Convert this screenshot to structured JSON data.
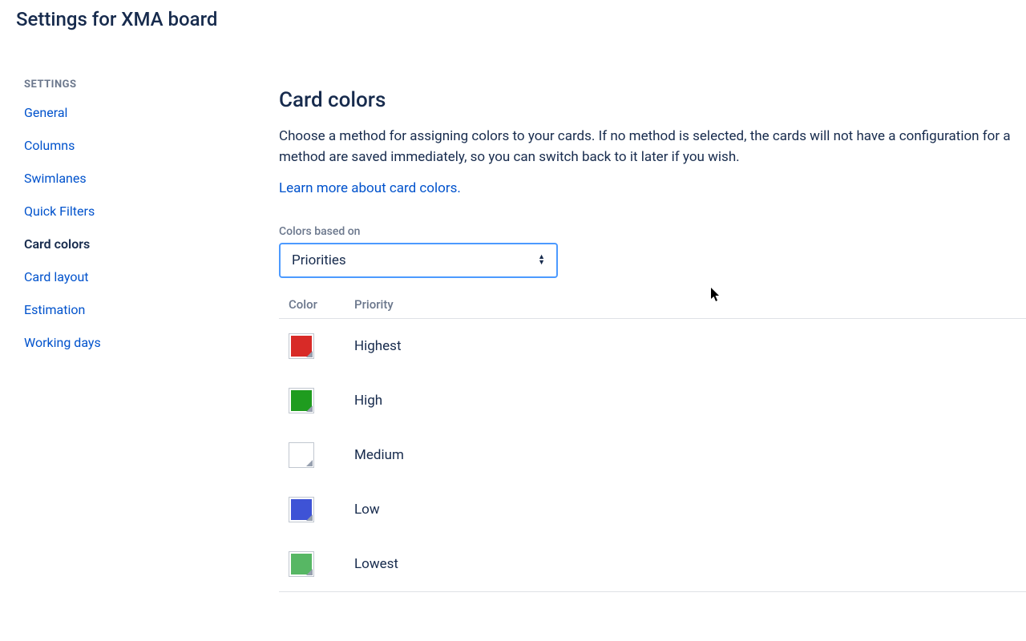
{
  "page": {
    "title": "Settings for XMA board"
  },
  "sidebar": {
    "header": "SETTINGS",
    "items": [
      {
        "label": "General",
        "active": false
      },
      {
        "label": "Columns",
        "active": false
      },
      {
        "label": "Swimlanes",
        "active": false
      },
      {
        "label": "Quick Filters",
        "active": false
      },
      {
        "label": "Card colors",
        "active": true
      },
      {
        "label": "Card layout",
        "active": false
      },
      {
        "label": "Estimation",
        "active": false
      },
      {
        "label": "Working days",
        "active": false
      }
    ]
  },
  "main": {
    "heading": "Card colors",
    "description_line1": "Choose a method for assigning colors to your cards. If no method is selected, the cards will not have a",
    "description_line2": "configuration for a method are saved immediately, so you can switch back to it later if you wish.",
    "learn_more": "Learn more about card colors.",
    "select_label": "Colors based on",
    "select_value": "Priorities",
    "table": {
      "headers": {
        "color": "Color",
        "priority": "Priority"
      },
      "rows": [
        {
          "color": "#D82A27",
          "label": "Highest"
        },
        {
          "color": "#1F9C1F",
          "label": "High"
        },
        {
          "color": "#FFFFFF",
          "label": "Medium"
        },
        {
          "color": "#3E53D6",
          "label": "Low"
        },
        {
          "color": "#57B764",
          "label": "Lowest"
        }
      ]
    }
  }
}
